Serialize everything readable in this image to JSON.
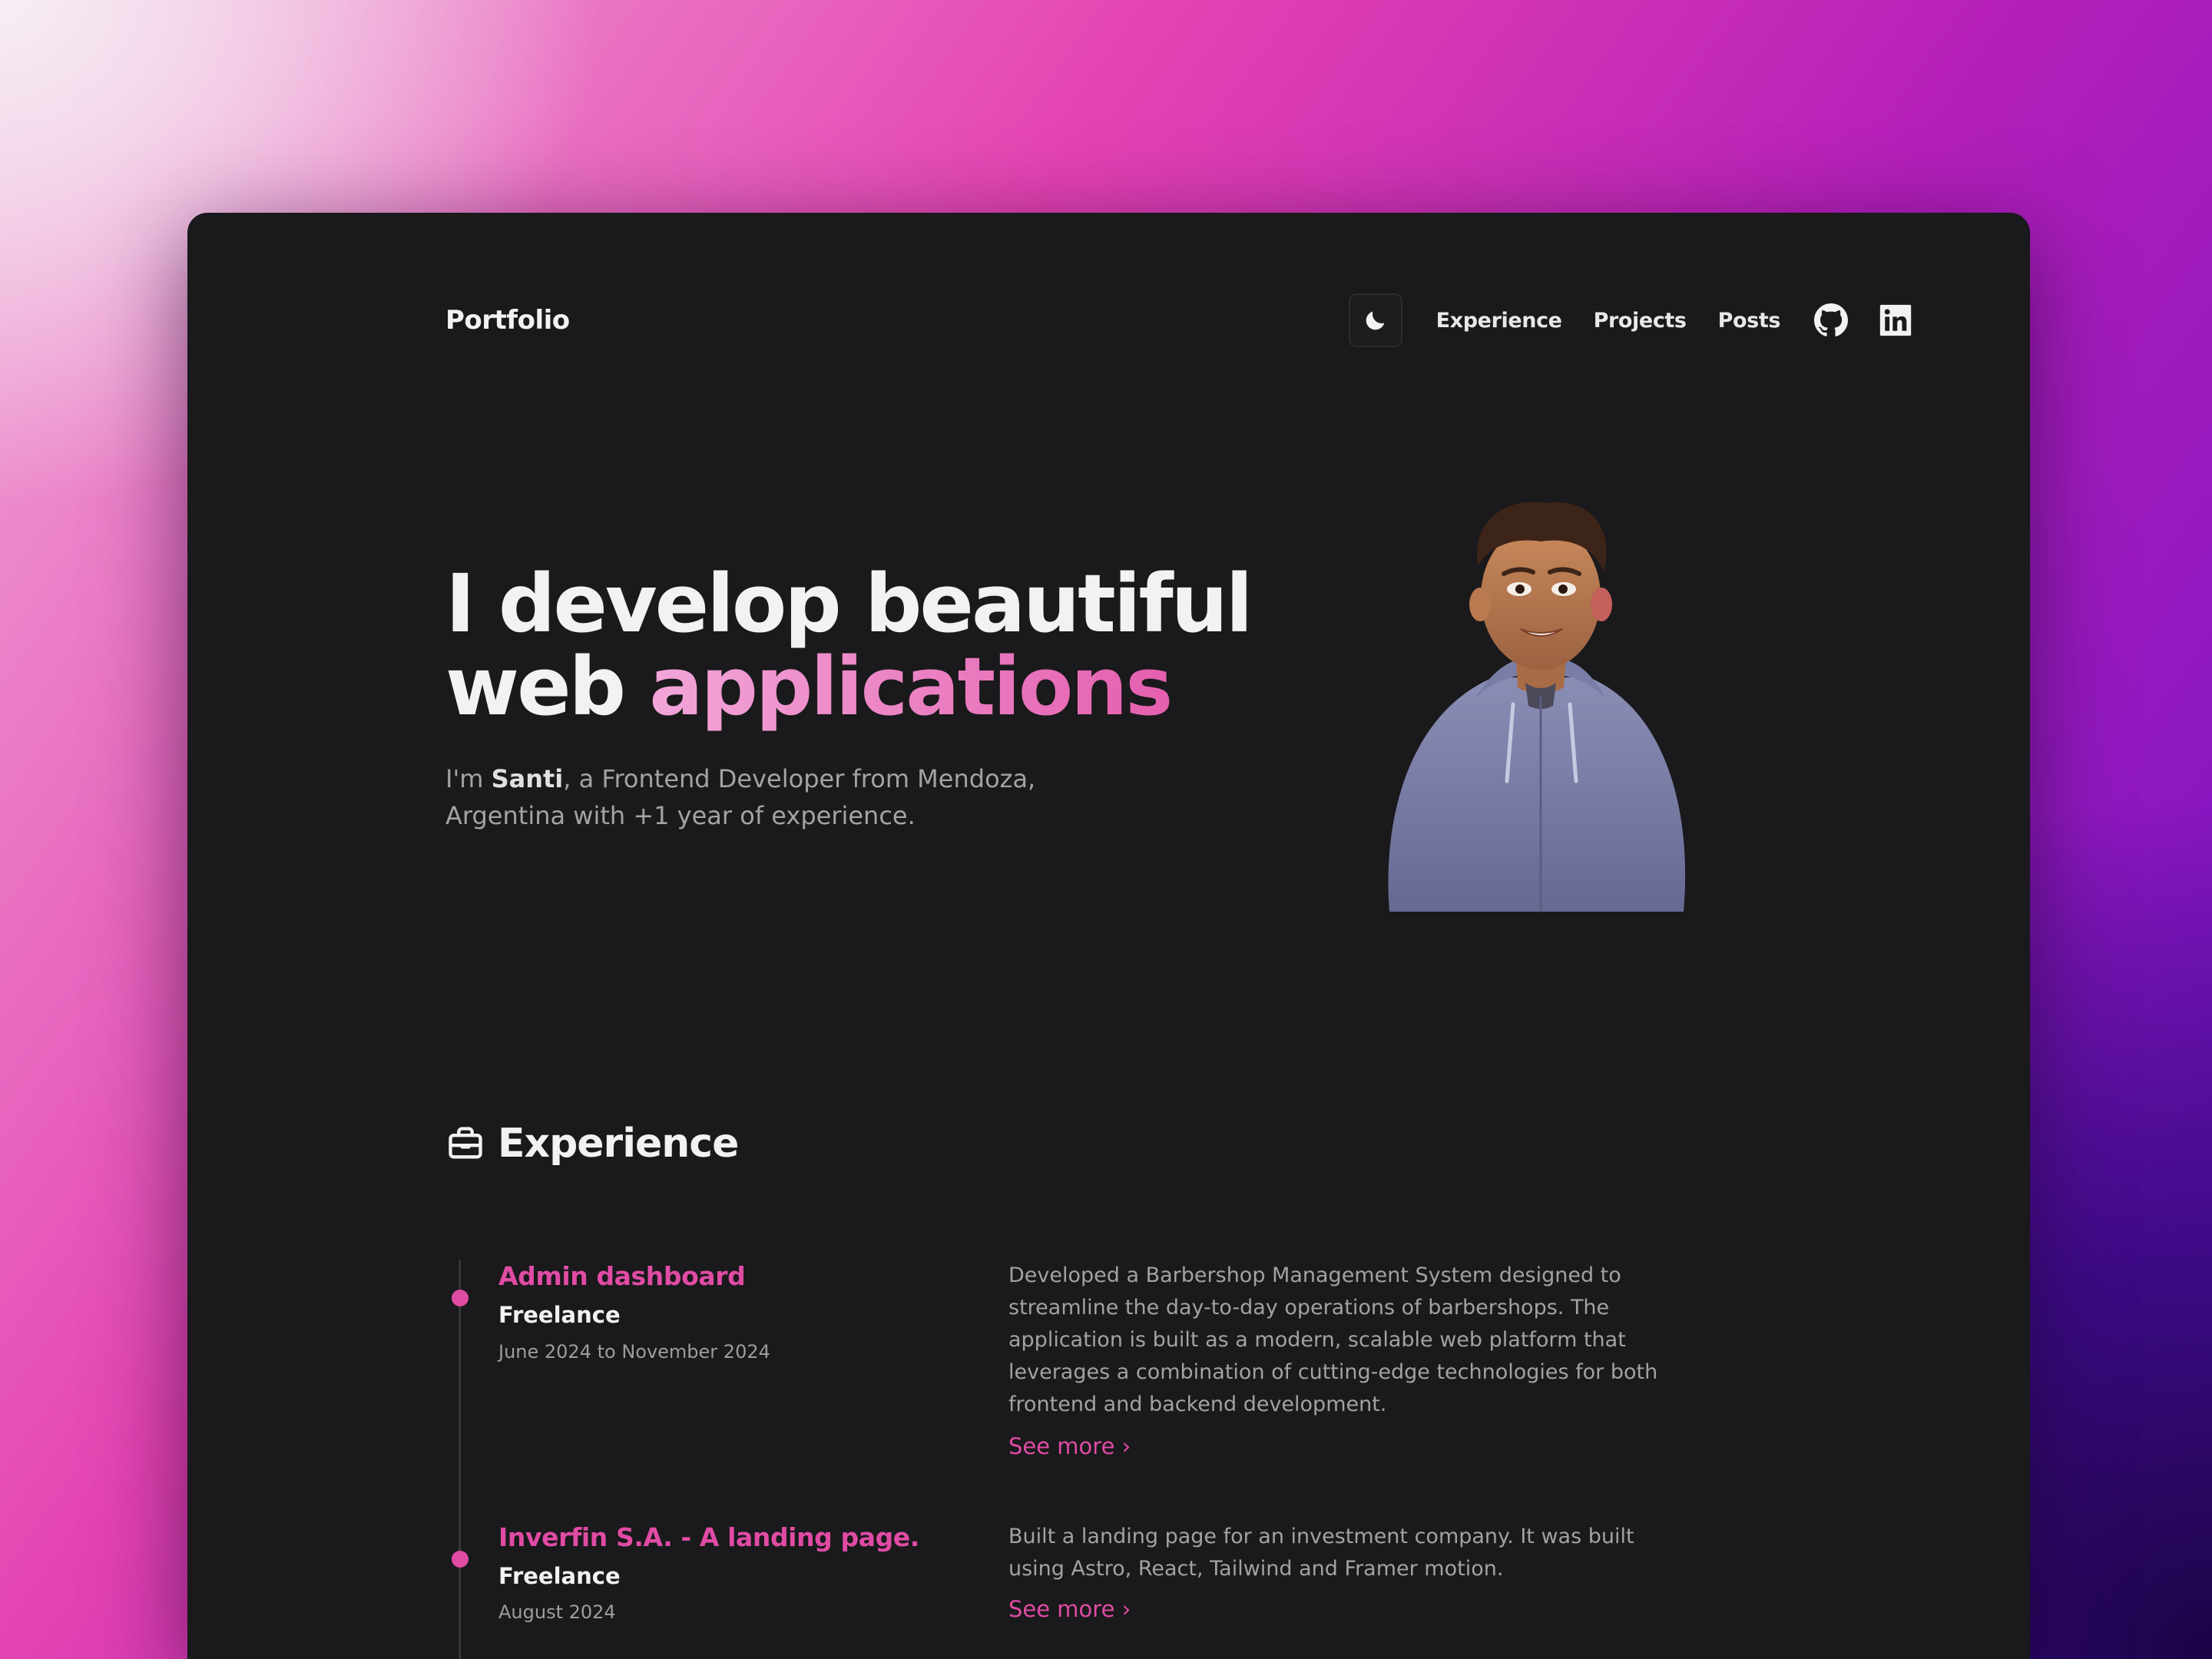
{
  "nav": {
    "logo": "Portfolio",
    "links": [
      "Experience",
      "Projects",
      "Posts"
    ],
    "icons": [
      "moon-icon",
      "github-icon",
      "linkedin-icon"
    ]
  },
  "hero": {
    "title_line1": "I develop beautiful",
    "title_line2_a": "web ",
    "title_line2_b": "applications",
    "sub_1": "I'm ",
    "sub_name": "Santi",
    "sub_2": ", a Frontend Developer from Mendoza, Argentina with +1 year of experience."
  },
  "experience": {
    "title": "Experience",
    "items": [
      {
        "title": "Admin dashboard",
        "company": "Freelance",
        "date": "June 2024 to November 2024",
        "description": "Developed a Barbershop Management System designed to streamline the day-to-day operations of barbershops. The application is built as a modern, scalable web platform that leverages a combination of cutting-edge technologies for both frontend and backend development.",
        "link": "See more ›"
      },
      {
        "title": "Inverfin S.A. - A landing page.",
        "company": "Freelance",
        "date": "August 2024",
        "description": "Built a landing page for an investment company. It was built using Astro, React, Tailwind and Framer motion.",
        "link": "See more ›"
      }
    ]
  },
  "colors": {
    "accent": "#e04ba4",
    "panel": "#1a191b",
    "text": "#f2f2f2"
  }
}
